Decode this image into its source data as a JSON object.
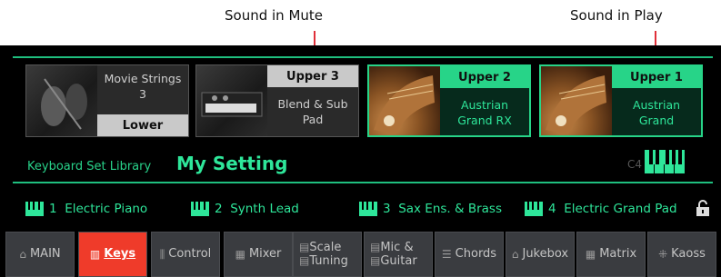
{
  "callouts": {
    "mute": "Sound in Mute",
    "play": "Sound in Play"
  },
  "sounds": [
    {
      "name": "Movie Strings\n3",
      "tag": "Lower",
      "state": "mute"
    },
    {
      "name": "Blend & Sub\nPad",
      "tag": "Upper 3",
      "state": "mute"
    },
    {
      "name": "Austrian\nGrand RX",
      "tag": "Upper 2",
      "state": "play"
    },
    {
      "name": "Austrian\nGrand",
      "tag": "Upper 1",
      "state": "play"
    }
  ],
  "library": {
    "label": "Keyboard Set Library",
    "setting": "My Setting",
    "octave": "C4"
  },
  "keyboard_sets": [
    {
      "num": "1",
      "name": "Electric Piano"
    },
    {
      "num": "2",
      "name": "Synth Lead"
    },
    {
      "num": "3",
      "name": "Sax Ens. & Brass"
    },
    {
      "num": "4",
      "name": "Electric Grand Pad"
    }
  ],
  "tabs": [
    {
      "label": "MAIN",
      "icon": "home-icon",
      "active": false
    },
    {
      "label": "Keys",
      "icon": "keyboard-icon",
      "active": true
    },
    {
      "label": "Control",
      "icon": "control-icon",
      "active": false
    },
    {
      "label": "Mixer",
      "icon": "mixer-icon",
      "active": false
    },
    {
      "label1": "Scale",
      "label2": "Tuning",
      "icon": "scale-icon",
      "active": false
    },
    {
      "label1": "Mic &",
      "label2": "Guitar",
      "icon": "mic-icon",
      "active": false
    },
    {
      "label": "Chords",
      "icon": "chords-icon",
      "active": false
    },
    {
      "label": "Jukebox",
      "icon": "jukebox-icon",
      "active": false
    },
    {
      "label": "Matrix",
      "icon": "matrix-icon",
      "active": false
    },
    {
      "label": "Kaoss",
      "icon": "kaoss-icon",
      "active": false
    }
  ],
  "colors": {
    "accent": "#2ee69a",
    "active_tab": "#ef3b2a",
    "callout_line": "#e0303a"
  }
}
